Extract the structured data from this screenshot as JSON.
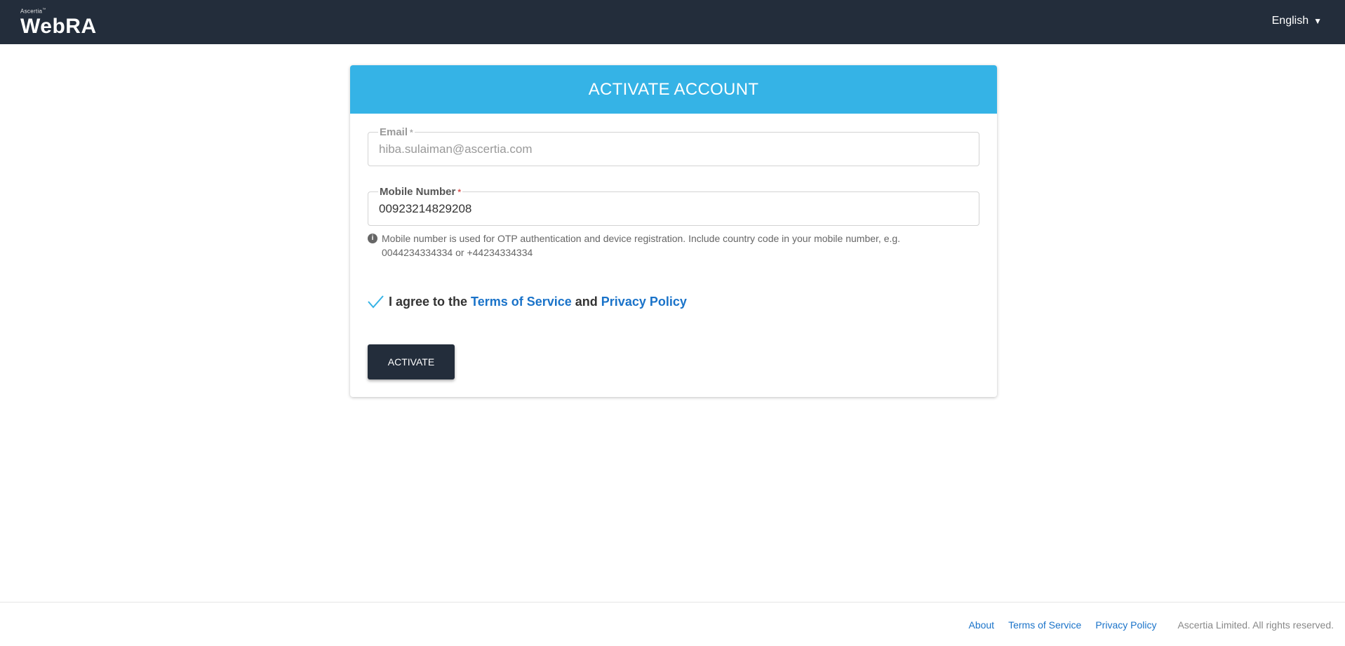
{
  "header": {
    "brand": "Ascertia",
    "brand_tm": "™",
    "app_name": "WebRA",
    "language": "English"
  },
  "card": {
    "title": "ACTIVATE ACCOUNT",
    "email": {
      "label": "Email",
      "required_marker": "*",
      "value": "hiba.sulaiman@ascertia.com"
    },
    "mobile": {
      "label": "Mobile Number",
      "required_marker": "*",
      "value": "00923214829208"
    },
    "hint": "Mobile number is used for OTP authentication and device registration. Include country code in your mobile number, e.g. 0044234334334 or +44234334334",
    "agree": {
      "prefix": "I agree to the",
      "terms": "Terms of Service",
      "and": "and",
      "privacy": "Privacy Policy",
      "checked": true
    },
    "activate_label": "ACTIVATE"
  },
  "footer": {
    "about": "About",
    "terms": "Terms of Service",
    "privacy": "Privacy Policy",
    "copyright": "Ascertia Limited. All rights reserved."
  },
  "colors": {
    "topbar": "#232d3b",
    "accent": "#35b3e6",
    "link": "#1a73c9",
    "button": "#232d3b"
  }
}
